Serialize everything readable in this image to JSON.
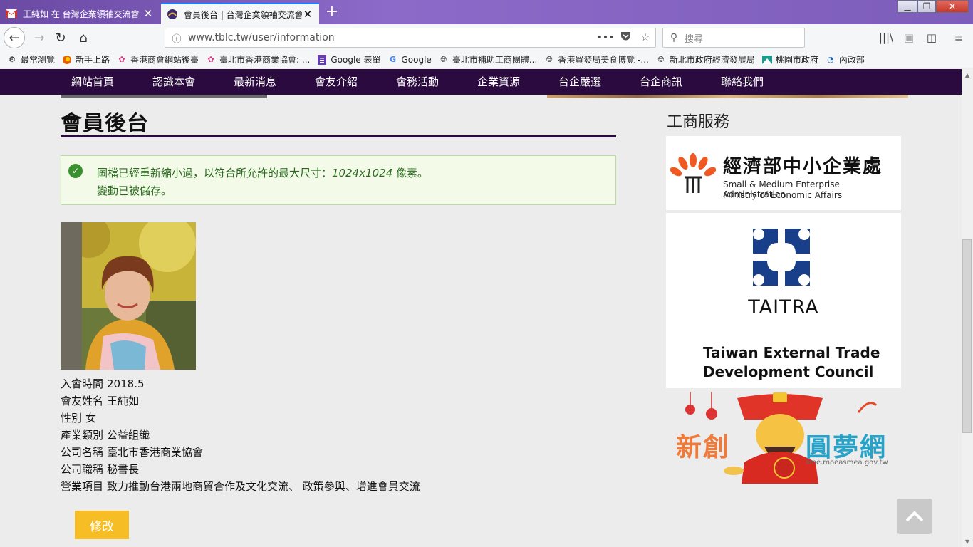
{
  "browser": {
    "tabs": [
      {
        "title": "王純如 在 台灣企業領袖交流會",
        "favicon": "gmail-icon",
        "active": false
      },
      {
        "title": "會員後台 | 台灣企業領袖交流會",
        "favicon": "site-icon",
        "active": true
      }
    ],
    "url": "www.tblc.tw/user/information",
    "search_placeholder": "搜尋",
    "bookmarks": [
      {
        "label": "最常瀏覽",
        "icon": "gear-icon"
      },
      {
        "label": "新手上路",
        "icon": "firefox-icon"
      },
      {
        "label": "香港商會網站後臺",
        "icon": "bauhinia-icon"
      },
      {
        "label": "臺北市香港商業協會: ...",
        "icon": "bauhinia-icon"
      },
      {
        "label": "Google 表單",
        "icon": "forms-icon"
      },
      {
        "label": "Google",
        "icon": "google-icon"
      },
      {
        "label": "臺北市補助工商團體...",
        "icon": "globe-icon"
      },
      {
        "label": "香港貿發局美食博覽 -...",
        "icon": "globe-icon"
      },
      {
        "label": "新北市政府經濟發展局",
        "icon": "globe-icon"
      },
      {
        "label": "桃園市政府",
        "icon": "flag-icon"
      },
      {
        "label": "內政部",
        "icon": "moi-icon"
      }
    ]
  },
  "site": {
    "nav": [
      "網站首頁",
      "認識本會",
      "最新消息",
      "會友介紹",
      "會務活動",
      "企業資源",
      "台企嚴選",
      "台企商訊",
      "聯絡我們"
    ]
  },
  "main": {
    "title": "會員後台",
    "alert": {
      "line1_prefix": "圖檔已經重新縮小過，以符合所允許的最大尺寸：",
      "line1_size": "1024x1024",
      "line1_suffix": " 像素。",
      "line2": "變動已被儲存。"
    },
    "profile": [
      {
        "label": "入會時間",
        "value": "2018.5"
      },
      {
        "label": "會友姓名",
        "value": "王純如"
      },
      {
        "label": "性別",
        "value": "女"
      },
      {
        "label": "產業類別",
        "value": "公益組織"
      },
      {
        "label": "公司名稱",
        "value": "臺北市香港商業協會"
      },
      {
        "label": "公司職稱",
        "value": "秘書長"
      },
      {
        "label": "營業項目",
        "value": "致力推動台港兩地商貿合作及文化交流、 政策參與、增進會員交流"
      }
    ],
    "edit_label": "修改"
  },
  "sidebar": {
    "title": "工商服務",
    "sme": {
      "cn": "經濟部中小企業處",
      "en1": "Small & Medium Enterprise Administration",
      "en2": "Ministry of Economic Affairs"
    },
    "taitra": {
      "name": "TAITRA",
      "desc1": "Taiwan External Trade",
      "desc2": "Development Council"
    },
    "dream": {
      "left": "新創",
      "right": "圓夢網",
      "url": "sme.moeasmea.gov.tw"
    }
  },
  "colors": {
    "nav_bg": "#2b0b3f",
    "edit_button": "#f7bd24",
    "alert_text": "#2a6a1e"
  }
}
